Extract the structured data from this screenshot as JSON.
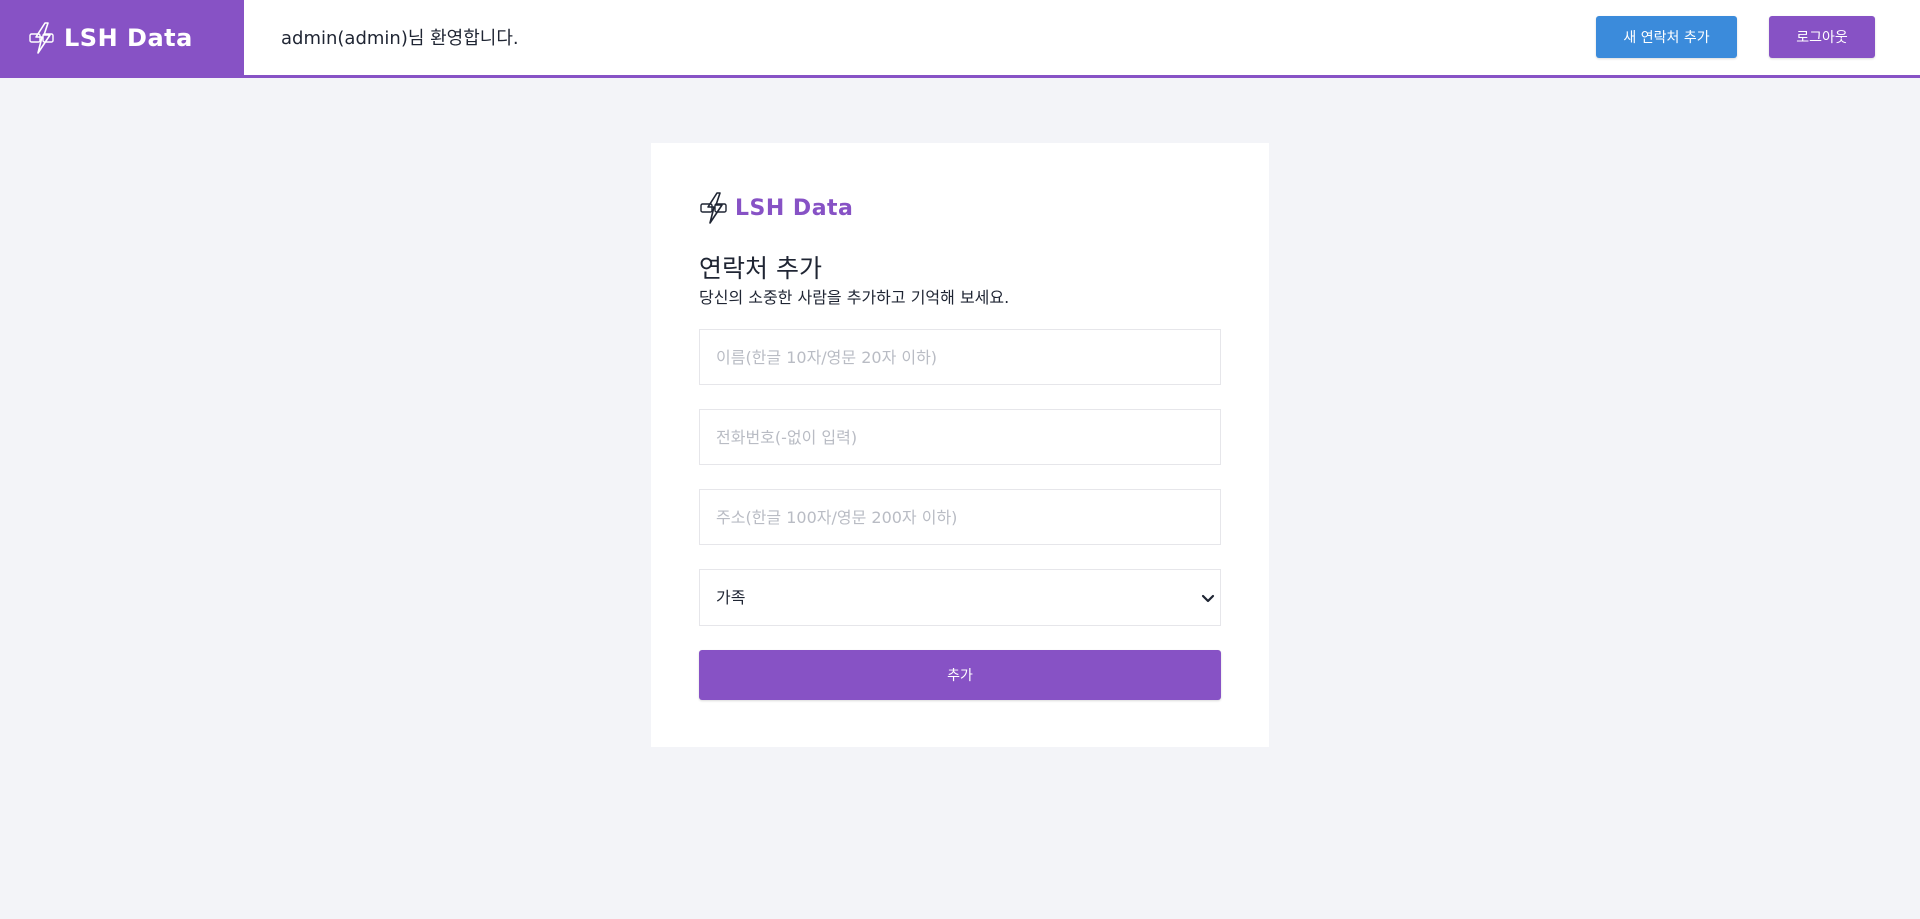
{
  "brand": {
    "name": "LSH Data",
    "logo_icon": "lsh-data-logo-icon"
  },
  "header": {
    "welcome_text": "admin(admin)님 환영합니다.",
    "new_contact_button": "새 연락처 추가",
    "logout_button": "로그아웃"
  },
  "form": {
    "title": "연락처 추가",
    "subtitle": "당신의 소중한 사람을 추가하고 기억해 보세요.",
    "name_placeholder": "이름(한글 10자/영문 20자 이하)",
    "name_value": "",
    "phone_placeholder": "전화번호(-없이 입력)",
    "phone_value": "",
    "address_placeholder": "주소(한글 100자/영문 200자 이하)",
    "address_value": "",
    "group_selected": "가족",
    "submit_button": "추가"
  },
  "colors": {
    "brand_purple": "#8752c5",
    "action_blue": "#3b8bdb",
    "page_background": "#f3f4f8"
  }
}
